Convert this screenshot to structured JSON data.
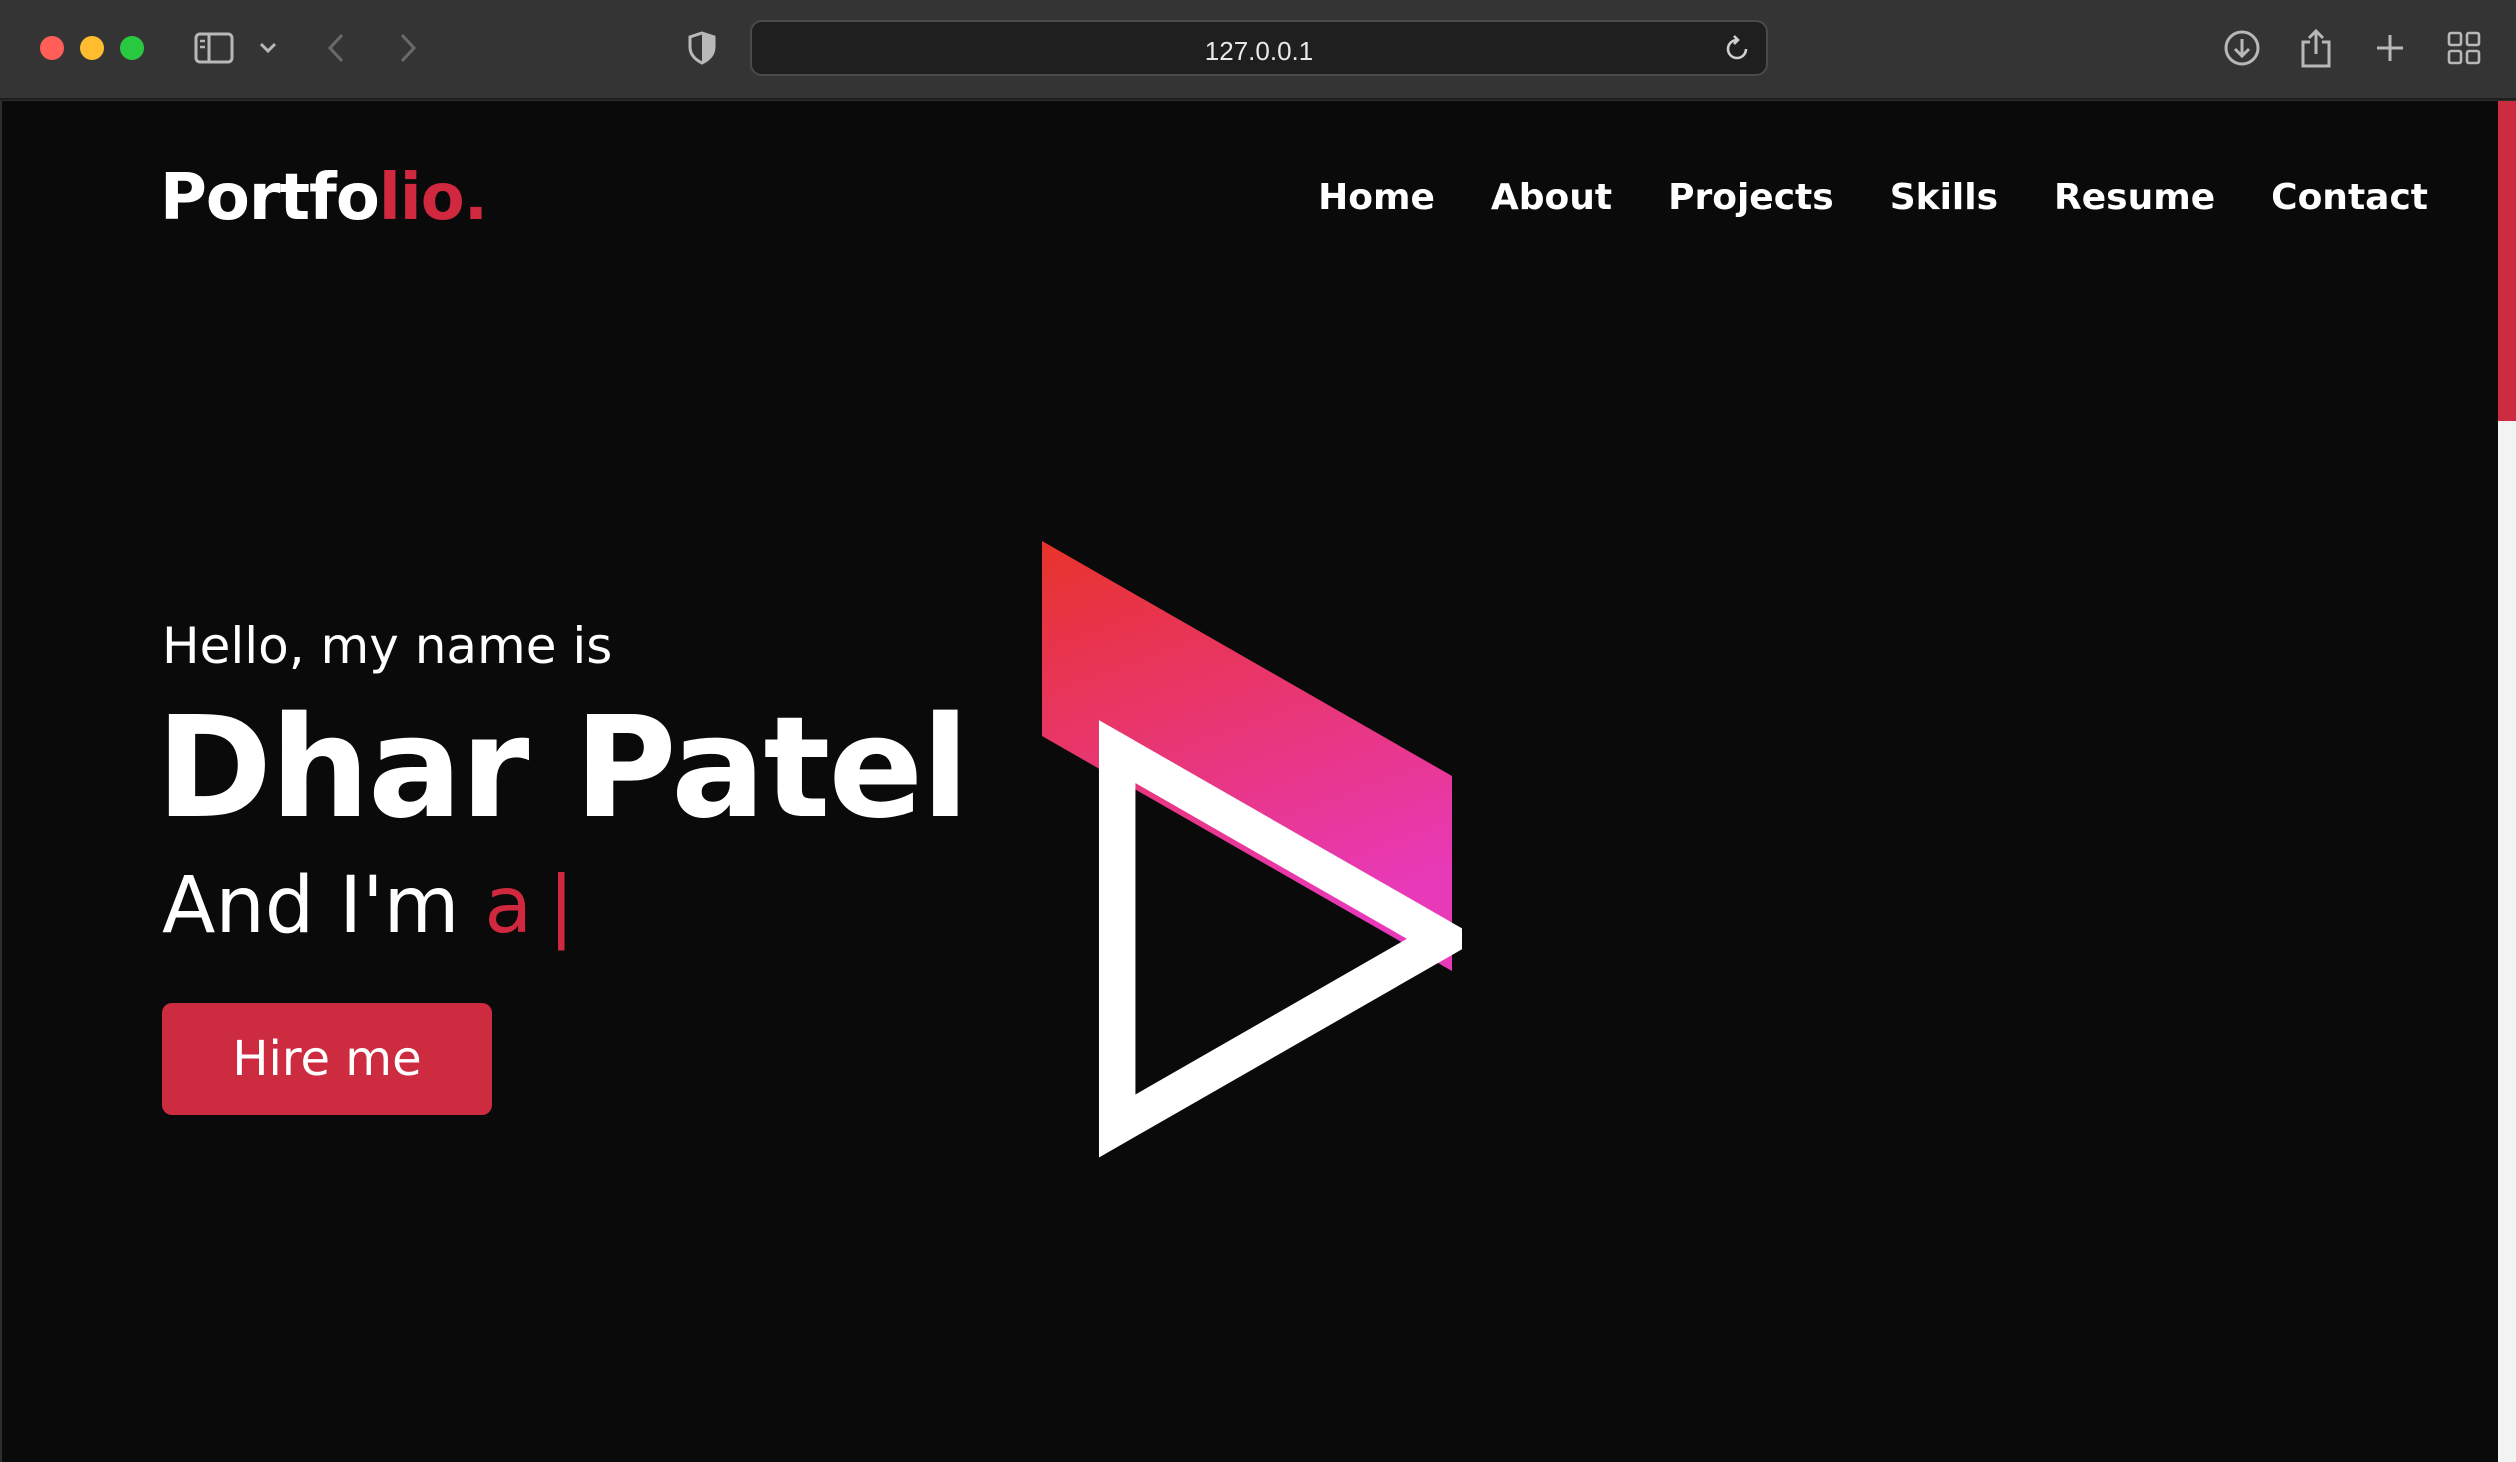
{
  "browser": {
    "url": "127.0.0.1",
    "icons": {
      "sidebar": "sidebar-icon",
      "sidebar_menu": "chevron-down-icon",
      "back": "chevron-left-icon",
      "forward": "chevron-right-icon",
      "privacy": "shield-icon",
      "reload": "reload-icon",
      "downloads": "download-icon",
      "share": "share-icon",
      "new_tab": "plus-icon",
      "tab_overview": "grid-icon"
    }
  },
  "page": {
    "logo": {
      "main": "Portfo",
      "accent": "lio."
    },
    "nav": [
      {
        "label": "Home"
      },
      {
        "label": "About"
      },
      {
        "label": "Projects"
      },
      {
        "label": "Skills"
      },
      {
        "label": "Resume"
      },
      {
        "label": "Contact"
      }
    ],
    "hero": {
      "greeting": "Hello, my name is",
      "name": "Dhar Patel",
      "role_prefix": "And I'm",
      "role_typed": "a",
      "cursor": "|",
      "button": "Hire me"
    },
    "colors": {
      "accent": "#cd2c40",
      "background": "#0a0a0b",
      "gradient_top": "#e8332a",
      "gradient_bottom": "#e839b9"
    }
  }
}
